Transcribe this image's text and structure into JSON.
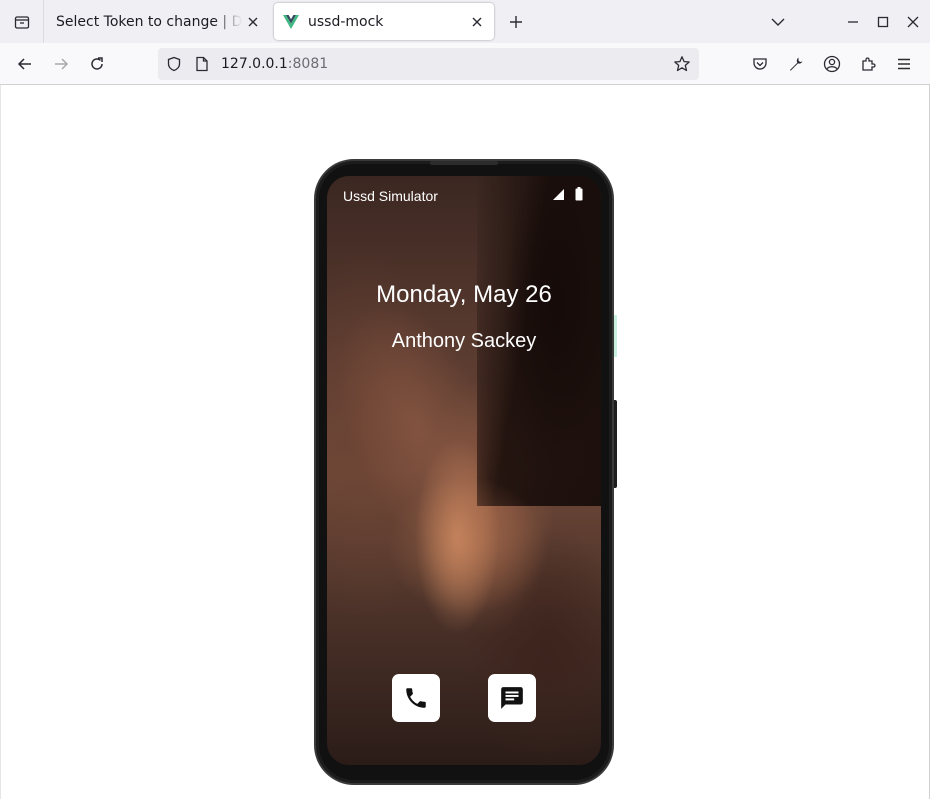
{
  "browser": {
    "tabs": [
      {
        "title": "Select Token to change | Djan",
        "active": false
      },
      {
        "title": "ussd-mock",
        "active": true,
        "favicon": "vue-icon"
      }
    ],
    "url": {
      "host": "127.0.0.1",
      "port": ":8081"
    },
    "icons": [
      "tab-list-icon",
      "close-icon",
      "new-tab-icon",
      "chevron-down-icon",
      "minimize-icon",
      "maximize-icon",
      "window-close-icon",
      "back-icon",
      "forward-icon",
      "reload-icon",
      "shield-icon",
      "page-icon",
      "star-icon",
      "pocket-icon",
      "wrench-icon",
      "account-icon",
      "extensions-icon",
      "menu-icon"
    ]
  },
  "phone": {
    "status_title": "Ussd Simulator",
    "status_icons": [
      "signal-icon",
      "battery-icon"
    ],
    "date": "Monday, May 26",
    "name": "Anthony Sackey",
    "apps": [
      {
        "name": "phone-app",
        "icon": "phone-icon"
      },
      {
        "name": "messages-app",
        "icon": "message-icon"
      }
    ]
  },
  "colors": {
    "tabstrip": "#f0f0f4",
    "navbar": "#f9f9fb",
    "urlbar": "#ececf0",
    "phone_body": "#111111",
    "vue_green": "#41b883"
  }
}
